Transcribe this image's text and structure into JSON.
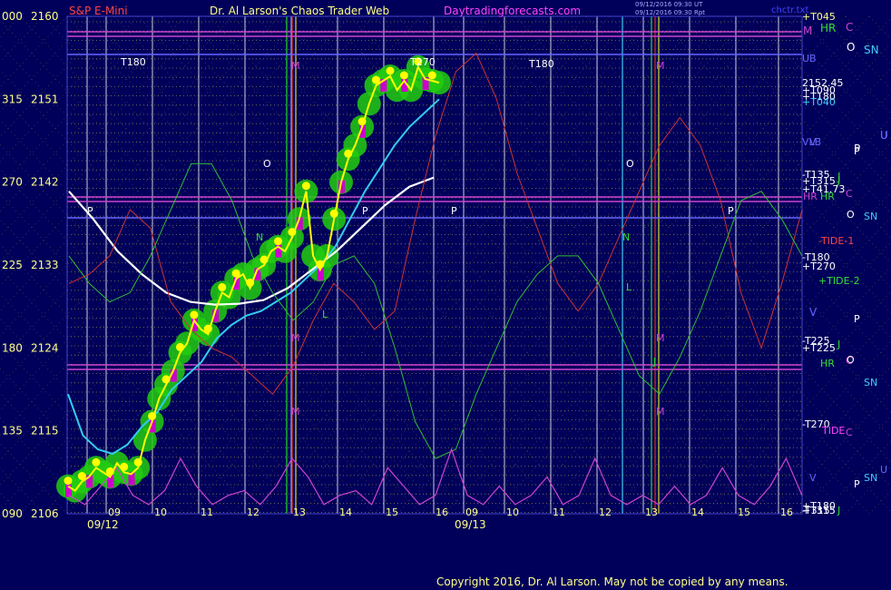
{
  "header": {
    "instrument": "S&P E-Mini",
    "site": "Dr. Al Larson's Chaos Trader Web",
    "url": "Daytradingforecasts.com",
    "stamp": [
      "09/12/2016 09:30 UT",
      "09/12/2016 09:30 Rpt"
    ],
    "corner": "chctr.txt"
  },
  "copyright": "Copyright 2016, Dr. Al Larson. May not be copied by any means.",
  "colors": {
    "background": "#00005a",
    "price": "#ffff00",
    "price_glow": "#22cc11",
    "ma_fast": "#33ccee",
    "ma_slow": "#ffffff",
    "tide1": "#cc3333",
    "tide2": "#33bb33",
    "cycle": "#cc44cc",
    "grid": "#dddd44"
  },
  "chart_data": {
    "type": "line",
    "title": "S&P E-Mini",
    "ylim": [
      2106,
      2160
    ],
    "y_tick_labels": [
      {
        "angle": "090",
        "price": "2106"
      },
      {
        "angle": "135",
        "price": "2115"
      },
      {
        "angle": "180",
        "price": "2124"
      },
      {
        "angle": "225",
        "price": "2133"
      },
      {
        "angle": "270",
        "price": "2142"
      },
      {
        "angle": "315",
        "price": "2151"
      },
      {
        "angle": "000",
        "price": "2160"
      }
    ],
    "x_hour_labels": [
      "09",
      "10",
      "11",
      "12",
      "13",
      "14",
      "15",
      "16",
      "09",
      "10",
      "11",
      "12",
      "13",
      "14",
      "15",
      "16"
    ],
    "x_date_labels": [
      "09/12",
      "09/13"
    ],
    "series": [
      {
        "name": "Price",
        "values": [
          2109,
          2108.5,
          2109.5,
          2110,
          2111,
          2110.5,
          2110,
          2111.5,
          2110.5,
          2110.3,
          2111,
          2114,
          2116,
          2118.5,
          2120,
          2121.5,
          2123.5,
          2124.5,
          2127,
          2126,
          2125.5,
          2128,
          2130,
          2129.5,
          2131.5,
          2132,
          2130.5,
          2132.5,
          2133,
          2134.5,
          2135,
          2134.5,
          2136,
          2138,
          2141,
          2134,
          2132.5,
          2134,
          2138,
          2142,
          2144.5,
          2146,
          2148,
          2150.5,
          2152.5,
          2153,
          2153.5,
          2152,
          2153,
          2152,
          2154.5,
          2153.2,
          2153,
          2152.8
        ]
      },
      {
        "name": "Fast average",
        "values": [
          2119,
          2114.5,
          2113,
          2112.5,
          2113.5,
          2115.5,
          2117,
          2119.5,
          2121,
          2122.5,
          2125,
          2126.5,
          2127.5,
          2128,
          2129,
          2130,
          2131.5,
          2133,
          2135,
          2138,
          2141,
          2143.5,
          2146,
          2148,
          2149.5,
          2151
        ]
      },
      {
        "name": "Slow average",
        "values": [
          2141,
          2138,
          2134.5,
          2132,
          2130,
          2129,
          2128.7,
          2128.8,
          2129.2,
          2130.5,
          2132.5,
          2134.5,
          2137,
          2139.5,
          2141.5,
          2142.5
        ]
      },
      {
        "name": "-TIDE-1",
        "values": [
          2131,
          2132,
          2134,
          2139,
          2137,
          2129,
          2126,
          2124,
          2123,
          2121,
          2119,
          2122,
          2127,
          2131,
          2129,
          2126,
          2128,
          2138,
          2147,
          2154,
          2156,
          2151,
          2143,
          2137,
          2131,
          2128,
          2131,
          2136,
          2141,
          2146,
          2149,
          2146,
          2140,
          2130,
          2124,
          2131,
          2139
        ]
      },
      {
        "name": "+TIDE-2",
        "values": [
          2134,
          2131,
          2129,
          2130,
          2134,
          2139,
          2144,
          2144,
          2140,
          2134,
          2130,
          2127,
          2129,
          2133,
          2134,
          2131,
          2124,
          2116,
          2112,
          2113,
          2119,
          2124,
          2129,
          2132,
          2134,
          2134,
          2131,
          2126,
          2121,
          2119,
          2123,
          2128,
          2134,
          2140,
          2141,
          2138,
          2134
        ]
      },
      {
        "name": "Cycle",
        "values": [
          2108,
          2107,
          2109,
          2111,
          2108,
          2107,
          2108.5,
          2112,
          2109,
          2107,
          2108,
          2108.5,
          2107,
          2109,
          2112,
          2110,
          2107,
          2108,
          2108.5,
          2107,
          2111,
          2109,
          2107,
          2108,
          2113,
          2108,
          2107,
          2109,
          2107,
          2108,
          2110,
          2107,
          2108,
          2112,
          2108,
          2107,
          2108,
          2107,
          2109,
          2107,
          2108,
          2111,
          2108,
          2107,
          2109,
          2112,
          2108
        ]
      }
    ],
    "right_annotations": [
      "+T045",
      "UB",
      "2152.45",
      "+T090",
      "+T180",
      "+T040",
      "VLB",
      "-T135",
      "+T315",
      "+T41.73",
      "-TIDE-1",
      "-T180",
      "+T270",
      "+TIDE-2",
      "-T225",
      "+T225",
      "-T270",
      "TIDE",
      "+T180",
      "-T315",
      "+T315"
    ],
    "flux_labels": [
      "M",
      "HR",
      "C",
      "O",
      "SN",
      "P",
      "U",
      "V",
      "J"
    ],
    "chart_marks": [
      "T180",
      "T270",
      "T180",
      "O",
      "O",
      "P",
      "P",
      "P",
      "P",
      "N",
      "N",
      "M",
      "M",
      "M",
      "M",
      "M",
      "M",
      "HR",
      "HR",
      "HR",
      "C",
      "C",
      "C",
      "O",
      "O",
      "SN",
      "SN",
      "SN",
      "P",
      "P",
      "P",
      "U",
      "U",
      "V",
      "V",
      "J",
      "J",
      "J",
      "J",
      "L",
      "L"
    ]
  }
}
